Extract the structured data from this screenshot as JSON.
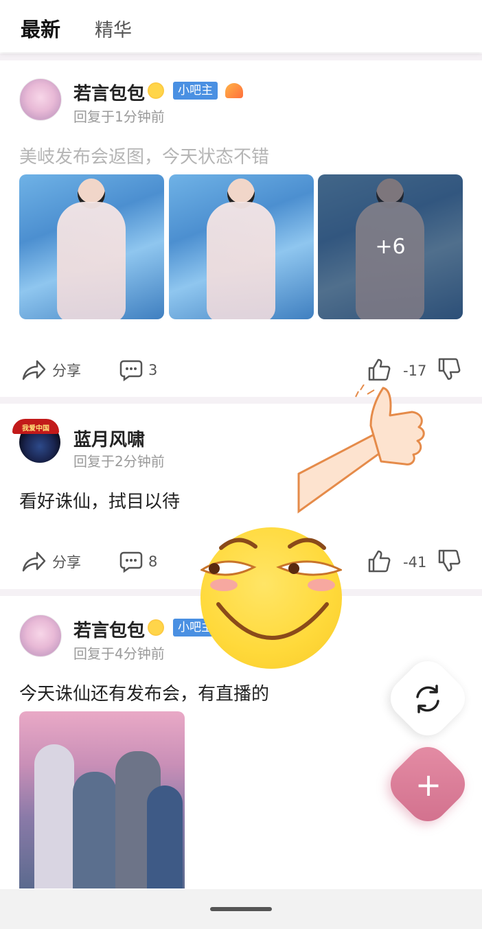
{
  "tabs": [
    {
      "label": "最新",
      "active": true
    },
    {
      "label": "精华",
      "active": false
    }
  ],
  "posts": [
    {
      "username": "若言包包",
      "badge": "小吧主",
      "meta": "回复于1分钟前",
      "content": "美岐发布会返图，今天状态不错",
      "images": [
        "dress-photo-1",
        "dress-photo-2",
        "dress-photo-3"
      ],
      "more_images": "+6",
      "share_label": "分享",
      "comments": "3",
      "votes": "-17"
    },
    {
      "username": "蓝月风啸",
      "avatar_text": "我爱中国",
      "meta": "回复于2分钟前",
      "content": "看好诛仙，拭目以待",
      "share_label": "分享",
      "comments": "8",
      "votes": "-41"
    },
    {
      "username": "若言包包",
      "badge": "小吧主",
      "meta": "回复于4分钟前",
      "content": "今天诛仙还有发布会，有直播的",
      "images": [
        "movie-poster"
      ]
    }
  ],
  "fab": {
    "refresh_icon": "refresh-icon",
    "add_icon": "plus-icon",
    "add_glyph": "+"
  },
  "colors": {
    "accent_blue": "#4a90e2",
    "fab_pink": "#d16f8c",
    "separator": "#f5f1f5"
  }
}
